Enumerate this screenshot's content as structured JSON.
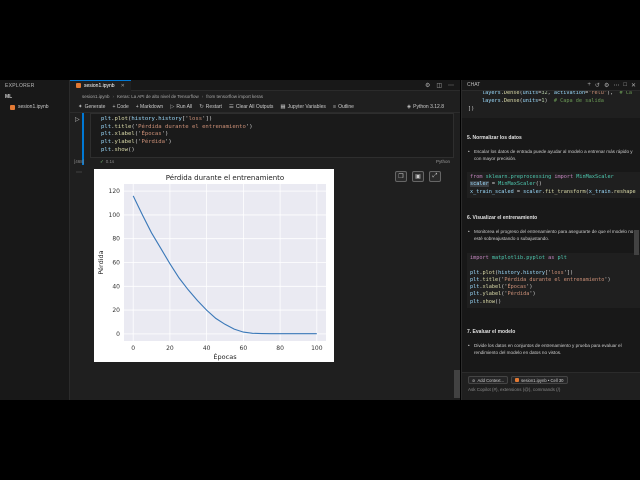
{
  "explorer": {
    "header": "EXPLORER",
    "folder": "ML",
    "file": "sesion1.ipynb"
  },
  "tabs": [
    {
      "label": "sesion1.ipynb"
    }
  ],
  "breadcrumb": {
    "items": [
      "sesion1.ipynb",
      "Keras: La API de alto nivel de Tensorflow",
      "from tensorflow import keras"
    ]
  },
  "toolbar": {
    "generate": "Generate",
    "code": "+ Code",
    "markdown": "+ Markdown",
    "run_all": "Run All",
    "restart": "Restart",
    "clear_outputs": "Clear All Outputs",
    "variables": "Jupyter Variables",
    "outline": "Outline",
    "kernel": "Python 3.12.8"
  },
  "cell": {
    "code_lines": [
      [
        [
          "var",
          "plt"
        ],
        [
          "p",
          "."
        ],
        [
          "fn",
          "plot"
        ],
        [
          "p",
          "("
        ],
        [
          "var",
          "history"
        ],
        [
          "p",
          "."
        ],
        [
          "var",
          "history"
        ],
        [
          "p",
          "['"
        ],
        [
          "str",
          "loss"
        ],
        [
          "p",
          "'])"
        ]
      ],
      [
        [
          "var",
          "plt"
        ],
        [
          "p",
          "."
        ],
        [
          "fn",
          "title"
        ],
        [
          "p",
          "('"
        ],
        [
          "str",
          "Pérdida durante el entrenamiento"
        ],
        [
          "p",
          "')"
        ]
      ],
      [
        [
          "var",
          "plt"
        ],
        [
          "p",
          "."
        ],
        [
          "fn",
          "xlabel"
        ],
        [
          "p",
          "('"
        ],
        [
          "str",
          "Épocas"
        ],
        [
          "p",
          "')"
        ]
      ],
      [
        [
          "var",
          "plt"
        ],
        [
          "p",
          "."
        ],
        [
          "fn",
          "ylabel"
        ],
        [
          "p",
          "('"
        ],
        [
          "str",
          "Pérdida"
        ],
        [
          "p",
          "')"
        ]
      ],
      [
        [
          "var",
          "plt"
        ],
        [
          "p",
          "."
        ],
        [
          "fn",
          "show"
        ],
        [
          "p",
          "()"
        ]
      ]
    ],
    "exec_count": "[468]",
    "exec_time": "0.1s",
    "language": "Python"
  },
  "chart_data": {
    "type": "line",
    "title": "Pérdida durante el entrenamiento",
    "xlabel": "Épocas",
    "ylabel": "Pérdida",
    "xlim": [
      -5,
      105
    ],
    "ylim": [
      -6,
      126
    ],
    "xticks": [
      0,
      20,
      40,
      60,
      80,
      100
    ],
    "yticks": [
      0,
      20,
      40,
      60,
      80,
      100,
      120
    ],
    "grid": true,
    "line_color": "#3a78b8",
    "background": "#eaeaf2",
    "series": [
      {
        "x": [
          0,
          5,
          10,
          15,
          20,
          25,
          30,
          35,
          40,
          45,
          50,
          55,
          60,
          65,
          70,
          75,
          80,
          85,
          90,
          95,
          100
        ],
        "y": [
          116,
          100,
          85,
          72,
          59,
          47,
          37,
          28,
          20,
          13,
          8,
          4,
          1.5,
          0.5,
          0.2,
          0.1,
          0.1,
          0.1,
          0.1,
          0.1,
          0.1
        ]
      }
    ]
  },
  "chat": {
    "header": "CHAT",
    "top_code": [
      "layers.Dense(units=32, activation=\"relu\"),  # Ca",
      "layers.Dense(units=1)  # Capa de salida",
      "])"
    ],
    "sections": [
      {
        "title": "5. Normalizar los datos",
        "bullet": "Escalar los datos de entrada puede ayudar al modelo a entrenar más rápido y con mayor precisión."
      },
      {
        "title": "6. Visualizar el entrenamiento",
        "bullet": "Monitorea el progreso del entrenamiento para asegurarte de que el modelo no esté sobreajustando o subajustando."
      },
      {
        "title": "7. Evaluar el modelo",
        "bullet": "Divide los datos en conjuntos de entrenamiento y prueba para evaluar el rendimiento del modelo en datos no vistos."
      }
    ],
    "code_norm": [
      "from sklearn.preprocessing import MinMaxScaler",
      "scaler = MinMaxScaler()",
      "x_train_scaled = scaler.fit_transform(x_train.reshape"
    ],
    "code_vis": [
      "import matplotlib.pyplot as plt",
      "",
      "plt.plot(history.history['loss'])",
      "plt.title('Pérdida durante el entrenamiento')",
      "plt.xlabel('Épocas')",
      "plt.ylabel('Pérdida')",
      "plt.show()"
    ],
    "context_chip": "Add Context...",
    "file_chip": "sesion1.ipynb • Cell 30",
    "input_placeholder": "Ask Copilot (#), extensions (@), commands (/)"
  }
}
